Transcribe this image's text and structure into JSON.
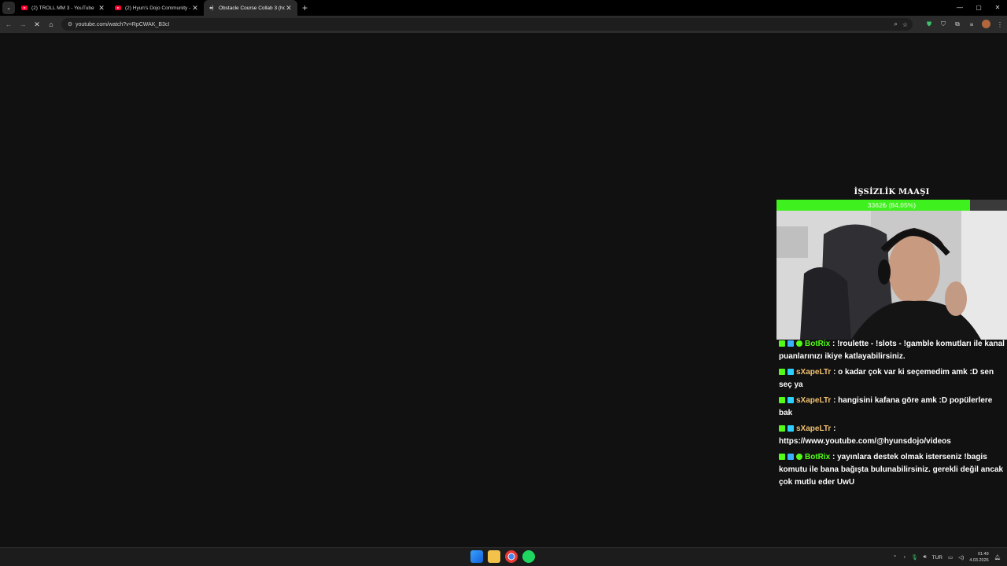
{
  "browser": {
    "tabs": [
      {
        "title": "(2) TROLL MM 3 - YouTube",
        "active": false,
        "icon": "youtube-icon"
      },
      {
        "title": "(2) Hyun's Dojo Community - Y",
        "active": false,
        "icon": "youtube-icon"
      },
      {
        "title": "Obstacle Course Collab 3 (hosti",
        "active": true,
        "icon": "audio-playing-icon"
      }
    ],
    "new_tab_label": "+",
    "url": "youtube.com/watch?v=RpCWAK_B3cI"
  },
  "overlay": {
    "goal_title": "İŞSİZLİK MAAŞI",
    "goal_text": "3362₺ (84.05%)",
    "goal_percent": 84.05,
    "goal_color": "#3ef01e"
  },
  "chat": [
    {
      "user": "BotRix",
      "text": ": !roulette - !slots - !gamble komutları ile kanal puanlarınızı ikiye katlayabilirsiniz.",
      "bot": true
    },
    {
      "user": "sXapeLTr",
      "text": ": o kadar çok var ki seçemedim amk :D sen seç ya",
      "bot": false
    },
    {
      "user": "sXapeLTr",
      "text": ": hangisini kafana göre amk :D popülerlere bak",
      "bot": false
    },
    {
      "user": "sXapeLTr",
      "text": ": https://www.youtube.com/@hyunsdojo/videos",
      "bot": false
    },
    {
      "user": "BotRix",
      "text": ": yayınlara destek olmak isterseniz !bagis komutu ile bana bağışta bulunabilirsiniz. gerekli değil ancak çok mutlu eder UwU",
      "bot": true
    }
  ],
  "taskbar": {
    "lang": "TUR",
    "time": "01:49",
    "date": "4.03.2026"
  }
}
